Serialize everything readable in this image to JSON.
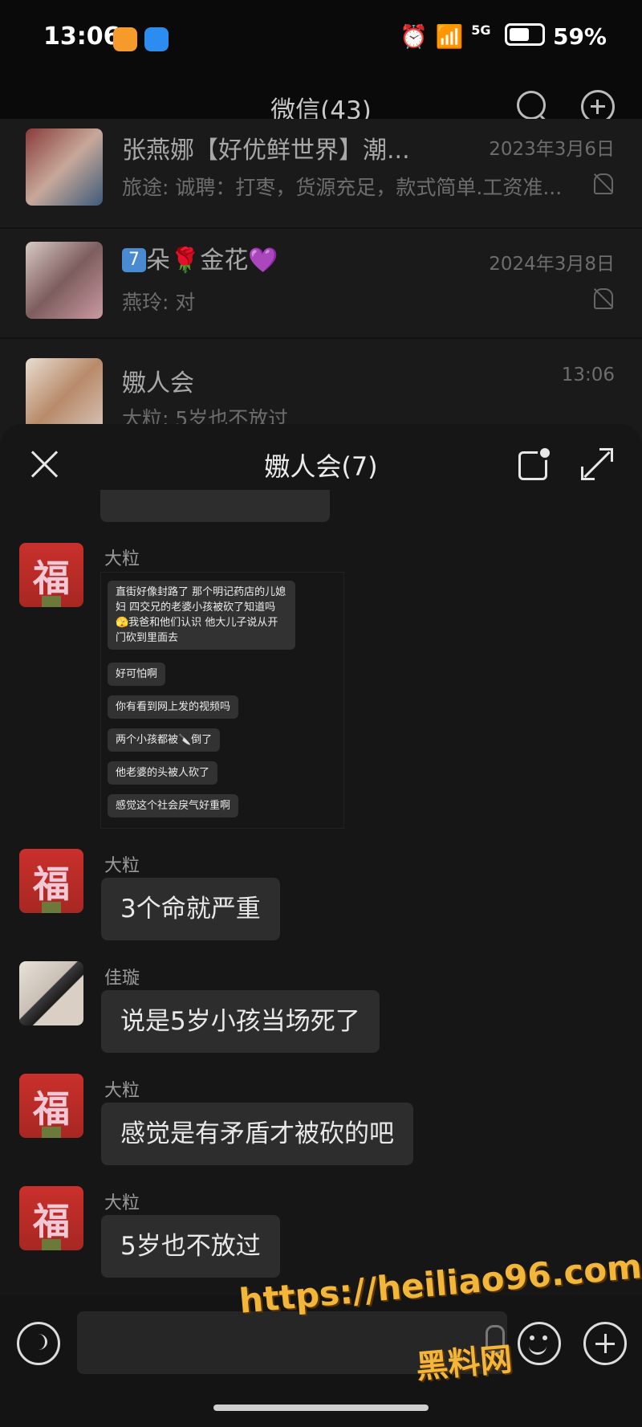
{
  "status_bar": {
    "time": "13:06",
    "signal": "5G",
    "battery": "59%"
  },
  "header": {
    "title": "微信(43)"
  },
  "chat_list": [
    {
      "name": "张燕娜【好优鲜世界】潮...",
      "date": "2023年3月6日",
      "preview": "旅途: 诚聘：打枣，货源充足，款式简单.工资准...",
      "muted": true
    },
    {
      "badge": "7",
      "name_text": "朵🌹金花💜",
      "date": "2024年3月8日",
      "preview": "燕玲: 对",
      "muted": true
    },
    {
      "name": "嫐人会",
      "date": "13:06",
      "preview": "大粒: 5岁也不放过",
      "muted": false
    }
  ],
  "sheet": {
    "title": "嫐人会(7)"
  },
  "screenshot_msgs": [
    "直街好像封路了 那个明记药店的儿媳妇 四交兄的老婆小孩被砍了知道吗🫣我爸和他们认识 他大儿子说从开门砍到里面去",
    "好可怕啊",
    "你有看到网上发的视频吗",
    "两个小孩都被🔪倒了",
    "他老婆的头被人砍了",
    "感觉这个社会戾气好重啊"
  ],
  "messages": [
    {
      "sender": "大粒",
      "text": ""
    },
    {
      "sender": "大粒",
      "text": "3个命就严重"
    },
    {
      "sender": "佳璇",
      "text": "说是5岁小孩当场死了"
    },
    {
      "sender": "大粒",
      "text": "感觉是有矛盾才被砍的吧"
    },
    {
      "sender": "大粒",
      "text": "5岁也不放过"
    }
  ],
  "avatar_text": "福",
  "watermark": {
    "url": "https://heiliao96.com",
    "name": "黑料网"
  }
}
